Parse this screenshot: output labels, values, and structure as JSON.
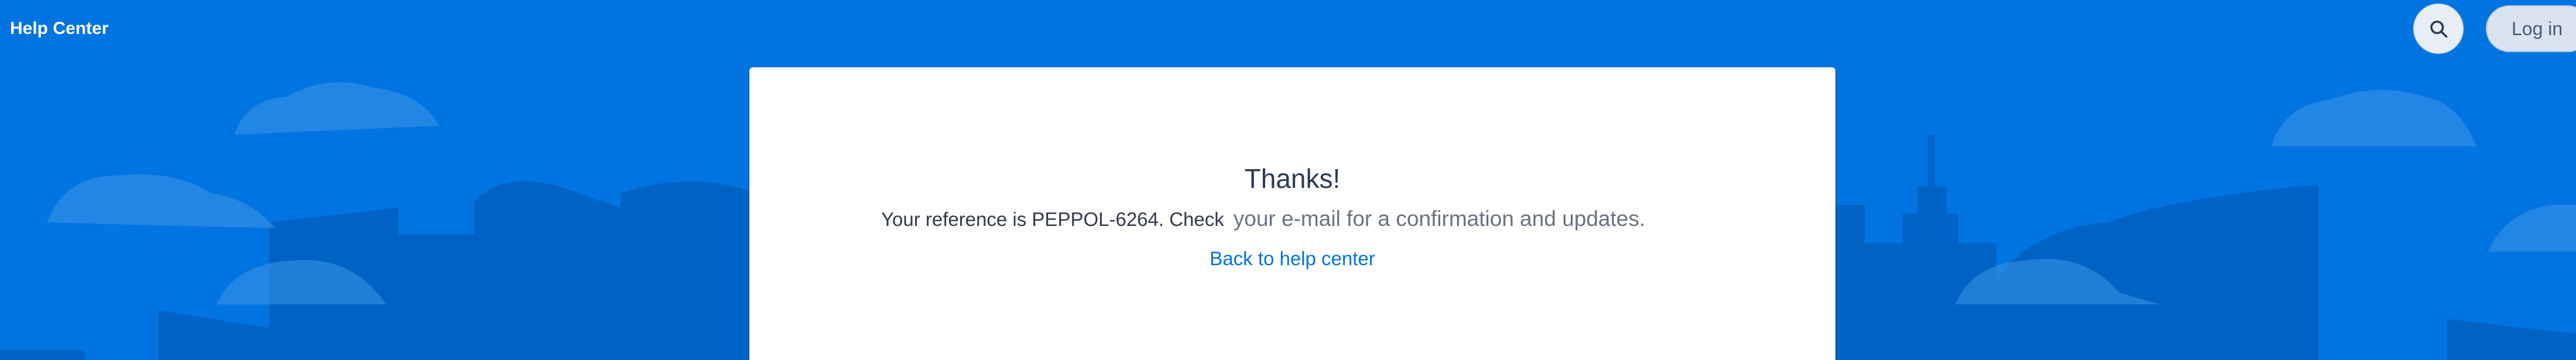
{
  "header": {
    "brand": "Help Center",
    "search_icon": "search-icon",
    "login_label": "Log in"
  },
  "confirmation": {
    "title": "Thanks!",
    "message_start": "Your reference is PEPPOL-6264. Check",
    "message_end": "your e-mail for a confirmation and updates.",
    "back_link": "Back to help center"
  },
  "colors": {
    "background": "#0074e0",
    "background_art": "#0063c4",
    "cloud": "#3d95e8",
    "card": "#ffffff",
    "link": "#0074e0"
  }
}
